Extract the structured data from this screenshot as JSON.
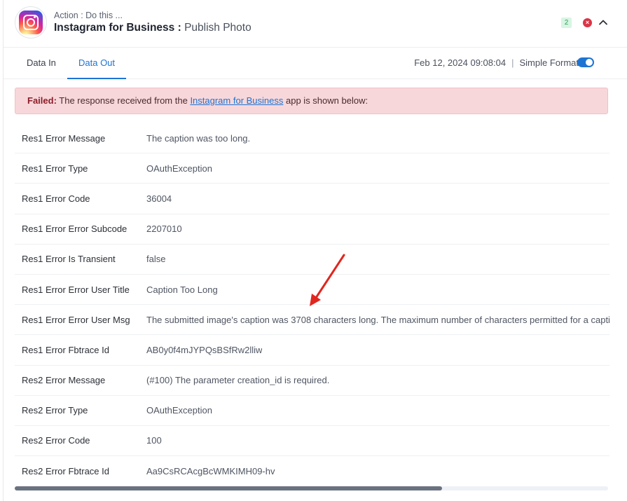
{
  "header": {
    "action_label": "Action : Do this ...",
    "app_name": "Instagram for Business :",
    "action_name": "Publish Photo",
    "badge_count": "2",
    "error_icon": "×"
  },
  "tabs": [
    {
      "label": "Data In",
      "active": false
    },
    {
      "label": "Data Out",
      "active": true
    }
  ],
  "meta": {
    "timestamp": "Feb 12, 2024 09:08:04",
    "separator": "|",
    "format_label": "Simple Format",
    "format_enabled": true
  },
  "alert": {
    "status": "Failed:",
    "text_before": " The response received from the ",
    "link_text": "Instagram for Business",
    "text_after": " app is shown below:"
  },
  "rows": [
    {
      "key": "Res1 Error Message",
      "value": "The caption was too long."
    },
    {
      "key": "Res1 Error Type",
      "value": "OAuthException"
    },
    {
      "key": "Res1 Error Code",
      "value": "36004"
    },
    {
      "key": "Res1 Error Error Subcode",
      "value": "2207010"
    },
    {
      "key": "Res1 Error Is Transient",
      "value": "false"
    },
    {
      "key": "Res1 Error Error User Title",
      "value": "Caption Too Long"
    },
    {
      "key": "Res1 Error Error User Msg",
      "value": "The submitted image's caption was 3708 characters long. The maximum number of characters permitted for a capti"
    },
    {
      "key": "Res1 Error Fbtrace Id",
      "value": "AB0y0f4mJYPQsBSfRw2lliw"
    },
    {
      "key": "Res2 Error Message",
      "value": "(#100) The parameter creation_id is required."
    },
    {
      "key": "Res2 Error Type",
      "value": "OAuthException"
    },
    {
      "key": "Res2 Error Code",
      "value": "100"
    },
    {
      "key": "Res2 Error Fbtrace Id",
      "value": "Aa9CsRCAcgBcWMKIMH09-hv"
    }
  ],
  "colors": {
    "accent": "#1d74d3",
    "error": "#d93646",
    "alert_bg": "#f8d7da",
    "annotation_arrow": "#e0261f"
  },
  "scroll": {
    "position_fraction": 0.72
  }
}
